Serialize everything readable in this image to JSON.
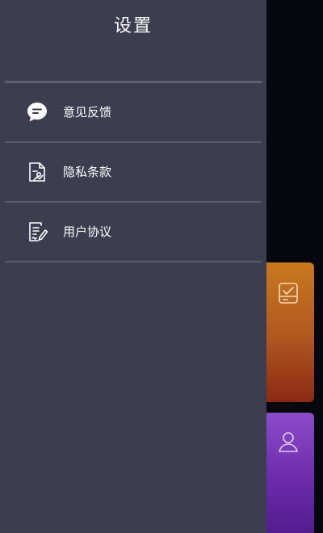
{
  "drawer": {
    "title": "设置",
    "items": [
      {
        "label": "意见反馈",
        "icon": "chat-bubble-icon"
      },
      {
        "label": "隐私条款",
        "icon": "document-image-icon"
      },
      {
        "label": "用户协议",
        "icon": "document-edit-icon"
      }
    ]
  },
  "background": {
    "cards": [
      {
        "icon": "clipboard-check-icon",
        "color": "#c8781e"
      },
      {
        "icon": "user-icon",
        "color": "#8c4cc9"
      }
    ]
  },
  "colors": {
    "drawer_bg": "#3d3d50",
    "divider": "#595970",
    "text": "#ffffff"
  }
}
